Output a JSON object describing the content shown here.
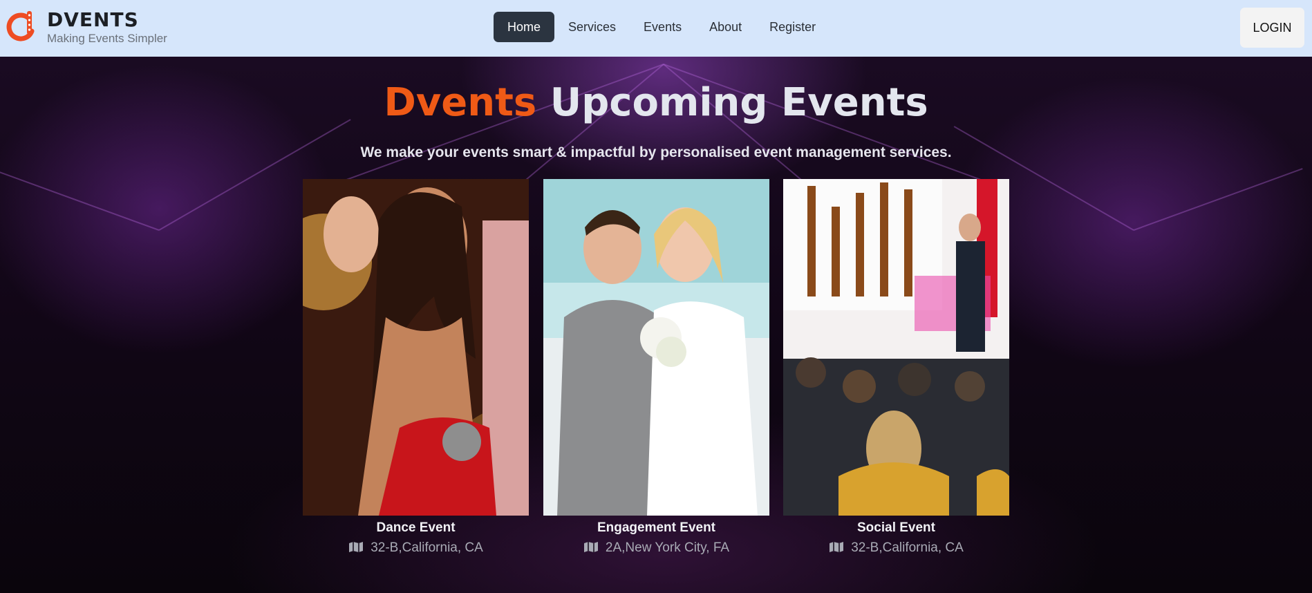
{
  "header": {
    "brand_name": "DVENTS",
    "brand_tagline": "Making Events Simpler",
    "nav": [
      {
        "label": "Home",
        "active": true
      },
      {
        "label": "Services",
        "active": false
      },
      {
        "label": "Events",
        "active": false
      },
      {
        "label": "About",
        "active": false
      },
      {
        "label": "Register",
        "active": false
      }
    ],
    "login_label": "LOGIN"
  },
  "hero": {
    "title_accent": "Dvents",
    "title_rest": "Upcoming Events",
    "subtitle": "We make your events smart & impactful by personalised event management services."
  },
  "events": [
    {
      "name": "Dance Event",
      "location": "32-B,California, CA"
    },
    {
      "name": "Engagement Event",
      "location": "2A,New York City, FA"
    },
    {
      "name": "Social Event",
      "location": "32-B,California, CA"
    }
  ],
  "colors": {
    "accent": "#ef5a16",
    "navbar_bg": "#d6e6fb",
    "active_nav_bg": "#2b3440",
    "login_bg": "#f3f3f3"
  },
  "icons": {
    "brand": "dvents-logo-icon",
    "location": "map-icon"
  }
}
